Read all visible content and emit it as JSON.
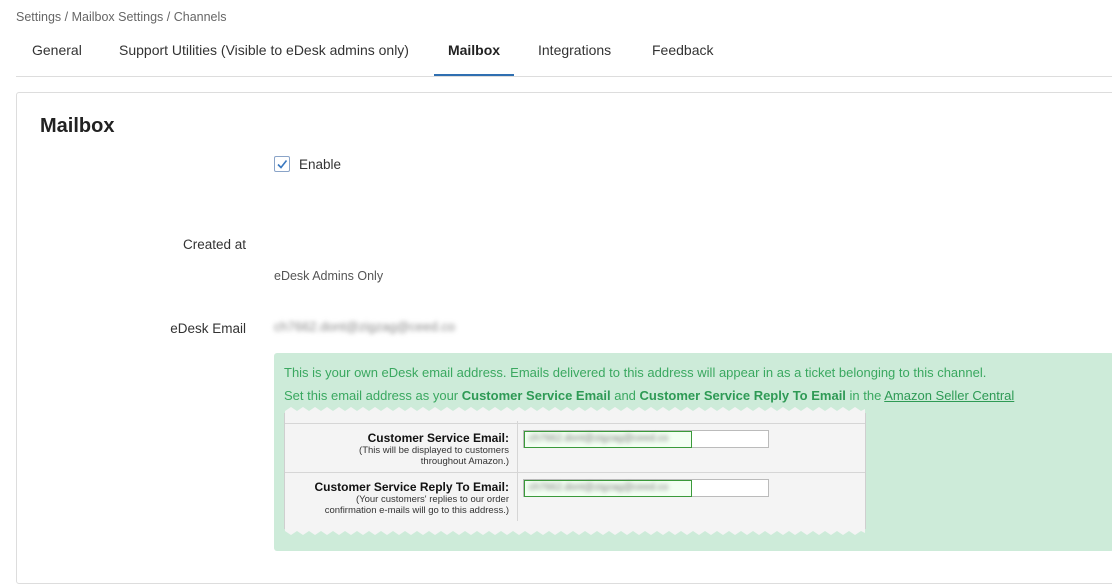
{
  "breadcrumb": "Settings / Mailbox Settings / Channels",
  "tabs": [
    {
      "label": "General"
    },
    {
      "label": "Support Utilities (Visible to eDesk admins only)"
    },
    {
      "label": "Mailbox"
    },
    {
      "label": "Integrations"
    },
    {
      "label": "Feedback"
    }
  ],
  "active_tab": "Mailbox",
  "card": {
    "title": "Mailbox",
    "enable_label": "Enable",
    "enable_checked": true,
    "created_at_label": "Created at",
    "admins_note": "eDesk Admins Only",
    "edesk_email_label": "eDesk Email",
    "edesk_email_value": "ch7662.dont@zigzag@ceed.co"
  },
  "info": {
    "line1": "This is your own eDesk email address. Emails delivered to this address will appear in as a ticket belonging to this channel.",
    "line2_pre": "Set this email address as your ",
    "line2_b1": "Customer Service Email",
    "line2_mid": " and ",
    "line2_b2": "Customer Service Reply To Email",
    "line2_post": " in the ",
    "line2_link": "Amazon Seller Central",
    "colors": {
      "bg": "#cdebd9",
      "text": "#3aa860"
    }
  },
  "amazon": {
    "row1_title": "Customer Service Email:",
    "row1_sub1": "(This will be displayed to customers",
    "row1_sub2": "throughout Amazon.)",
    "row1_value": "ch7662.dont@zigzag@ceed.co",
    "row2_title": "Customer Service Reply To Email:",
    "row2_sub1": "(Your customers' replies to our order",
    "row2_sub2": "confirmation e-mails will go to this address.)",
    "row2_value": "ch7662.dont@zigzag@ceed.co"
  }
}
